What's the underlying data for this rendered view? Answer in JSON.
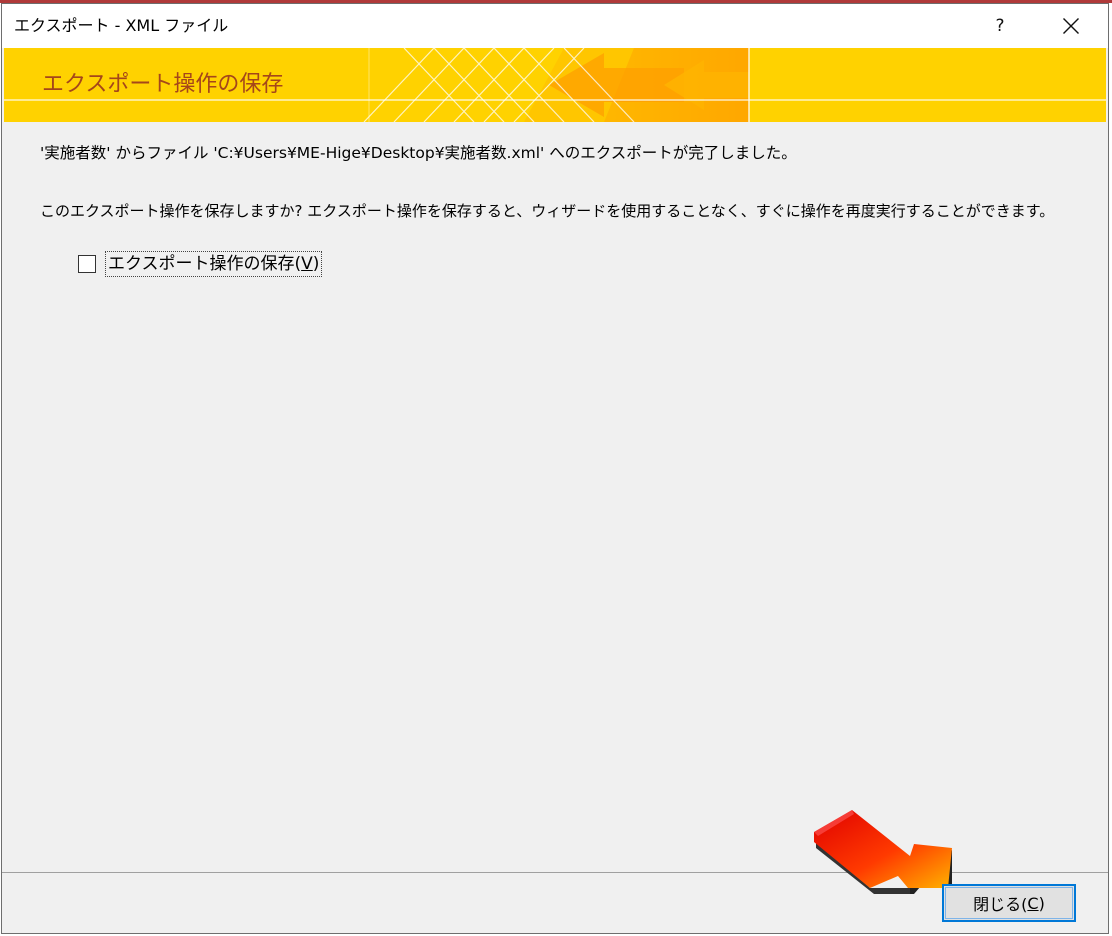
{
  "window": {
    "title": "エクスポート - XML ファイル",
    "help_glyph": "?"
  },
  "banner": {
    "title": "エクスポート操作の保存"
  },
  "content": {
    "result_message": "'実施者数' からファイル 'C:¥Users¥ME-Hige¥Desktop¥実施者数.xml' へのエクスポートが完了しました。",
    "question": "このエクスポート操作を保存しますか? エクスポート操作を保存すると、ウィザードを使用することなく、すぐに操作を再度実行することができます。",
    "save_checkbox": {
      "label_prefix": "エクスポート操作の保存(",
      "mnemonic": "V",
      "label_suffix": ")",
      "checked": false
    }
  },
  "footer": {
    "close_button": {
      "label_prefix": "閉じる(",
      "mnemonic": "C",
      "label_suffix": ")"
    }
  },
  "colors": {
    "banner_bg": "#ffd200",
    "banner_title": "#a5461a",
    "focus_border": "#0078d7"
  }
}
